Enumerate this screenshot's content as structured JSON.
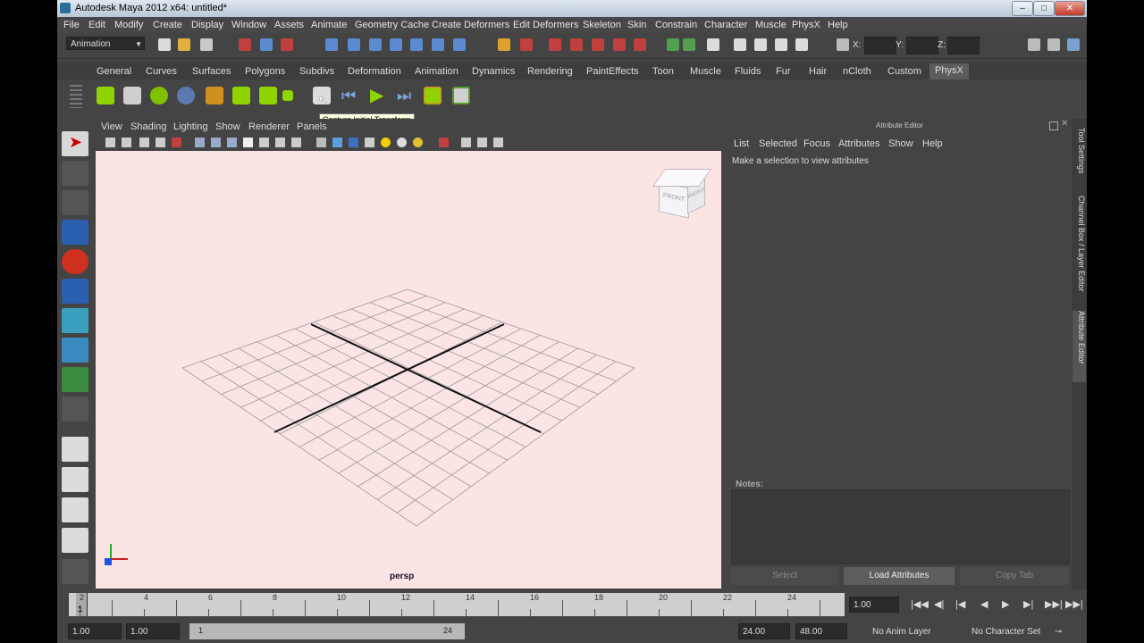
{
  "window": {
    "title": "Autodesk Maya 2012 x64: untitled*",
    "min": "–",
    "max": "□",
    "close": "✕"
  },
  "menubar": [
    "File",
    "Edit",
    "Modify",
    "Create",
    "Display",
    "Window",
    "Assets",
    "Animate",
    "Geometry Cache",
    "Create Deformers",
    "Edit Deformers",
    "Skeleton",
    "Skin",
    "Constrain",
    "Character",
    "Muscle",
    "PhysX",
    "Help"
  ],
  "statusline": {
    "mode": "Animation",
    "x_label": "X:",
    "y_label": "Y:",
    "z_label": "Z:"
  },
  "shelf_tabs": [
    "General",
    "Curves",
    "Surfaces",
    "Polygons",
    "Subdivs",
    "Deformation",
    "Animation",
    "Dynamics",
    "Rendering",
    "PaintEffects",
    "Toon",
    "Muscle",
    "Fluids",
    "Fur",
    "Hair",
    "nCloth",
    "Custom",
    "PhysX"
  ],
  "shelf_active": "PhysX",
  "tooltip": "Capture Initial Transform",
  "panel_menu": [
    "View",
    "Shading",
    "Lighting",
    "Show",
    "Renderer",
    "Panels"
  ],
  "viewport": {
    "camera": "persp",
    "cube_labels": {
      "front": "FRONT",
      "right": "RIGHT"
    }
  },
  "attribute_editor": {
    "title": "Attribute Editor",
    "menu": [
      "List",
      "Selected",
      "Focus",
      "Attributes",
      "Show",
      "Help"
    ],
    "message": "Make a selection to view attributes",
    "notes_label": "Notes:",
    "buttons": {
      "select": "Select",
      "load": "Load Attributes",
      "copy": "Copy Tab"
    }
  },
  "side_tabs": [
    "Tool Settings",
    "Channel Box / Layer Editor",
    "Attribute Editor"
  ],
  "timeslider": {
    "ticks": [
      "2",
      "4",
      "6",
      "8",
      "10",
      "12",
      "14",
      "16",
      "18",
      "20",
      "22",
      "24"
    ],
    "current_marker": "1",
    "current_frame": "1.00",
    "buttons": [
      "|◀◀",
      "◀|",
      "|◀",
      "◀",
      "▶",
      "▶|",
      "▶▶|",
      "▶▶|"
    ]
  },
  "rangeslider": {
    "start": "1.00",
    "playback_start": "1.00",
    "range_low": "1",
    "range_high": "24",
    "playback_end": "24.00",
    "end": "48.00",
    "anim_layer": "No Anim Layer",
    "character_set": "No Character Set"
  },
  "colors": {
    "viewport_bg": "#fde4e4",
    "panel": "#444444",
    "accent_green": "#8fd400"
  }
}
